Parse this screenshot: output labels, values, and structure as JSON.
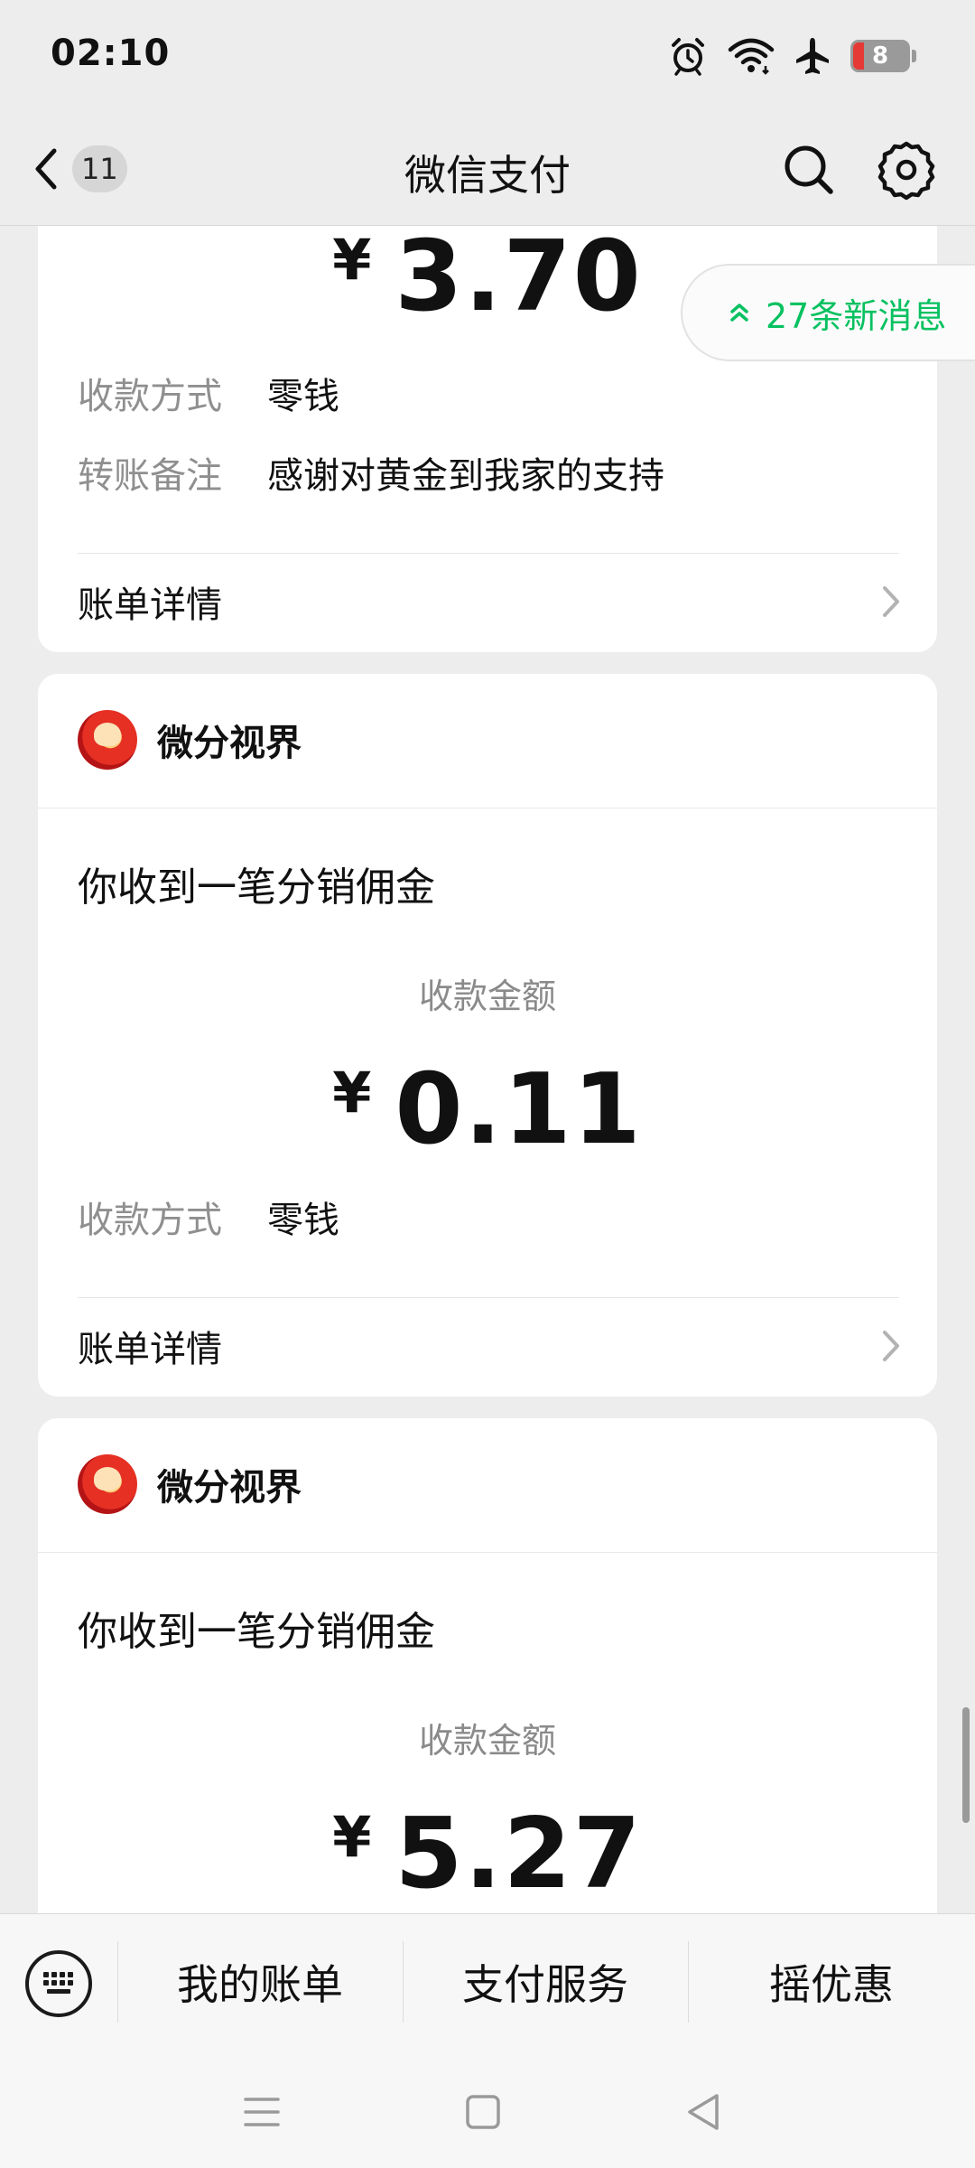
{
  "status_bar": {
    "time": "02:10",
    "battery_level": "8",
    "icons": [
      "alarm-icon",
      "wifi-icon",
      "airplane-icon",
      "battery-icon"
    ]
  },
  "header": {
    "back_badge": "11",
    "title": "微信支付",
    "icons": [
      "search-icon",
      "gear-icon"
    ]
  },
  "new_messages": {
    "text": "27条新消息",
    "color": "#07c160"
  },
  "cards": [
    {
      "amount": "3.70",
      "currency": "¥",
      "fields": [
        {
          "label": "收款方式",
          "value": "零钱"
        },
        {
          "label": "转账备注",
          "value": "感谢对黄金到我家的支持"
        }
      ],
      "detail_label": "账单详情"
    },
    {
      "merchant": "微分视界",
      "notice": "你收到一笔分销佣金",
      "amount_label": "收款金额",
      "currency": "¥",
      "amount": "0.11",
      "fields": [
        {
          "label": "收款方式",
          "value": "零钱"
        }
      ],
      "detail_label": "账单详情"
    },
    {
      "merchant": "微分视界",
      "notice": "你收到一笔分销佣金",
      "amount_label": "收款金额",
      "currency": "¥",
      "amount": "5.27"
    }
  ],
  "bottom_menu": {
    "items": [
      "我的账单",
      "支付服务",
      "摇优惠"
    ],
    "icons": [
      "keyboard-icon"
    ]
  },
  "nav_bar": {
    "icons": [
      "menu-icon",
      "home-icon",
      "back-icon"
    ]
  }
}
